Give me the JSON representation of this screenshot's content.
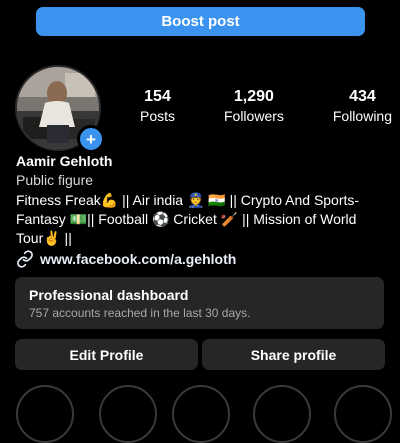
{
  "boost_label": "Boost post",
  "profile": {
    "stats": [
      {
        "value": "154",
        "label": "Posts"
      },
      {
        "value": "1,290",
        "label": "Followers"
      },
      {
        "value": "434",
        "label": "Following"
      }
    ],
    "name": "Aamir Gehloth",
    "category": "Public figure",
    "bio_line1": "Fitness Freak💪 || Air india 👮 🇮🇳 || Crypto And Sports-",
    "bio_line2": "Fantasy 💵|| Football ⚽ Cricket 🏏 || Mission of World",
    "bio_line3": "Tour✌️ ||",
    "link": "www.facebook.com/a.gehloth"
  },
  "dashboard": {
    "title": "Professional dashboard",
    "subtitle": "757 accounts reached in the last 30 days."
  },
  "buttons": {
    "edit": "Edit Profile",
    "share": "Share profile"
  },
  "avatar_add": "+",
  "colors": {
    "background": "#000000",
    "accent": "#3b93f0",
    "card": "#262626",
    "muted_text": "#a8a8a8"
  },
  "icons": [
    "add-story-icon",
    "link-icon"
  ]
}
